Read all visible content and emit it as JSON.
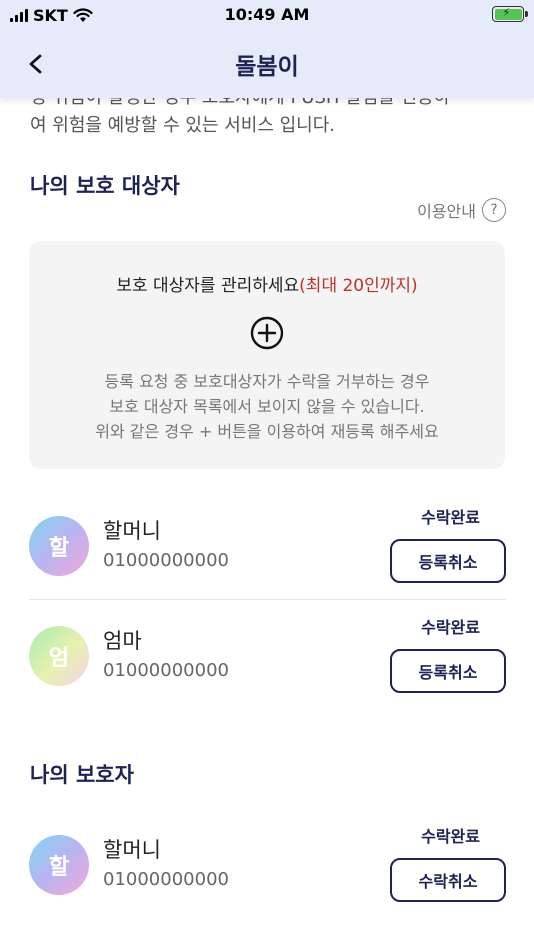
{
  "status_bar": {
    "carrier": "SKT",
    "time": "10:49 AM"
  },
  "header": {
    "title": "돌봄이"
  },
  "intro": {
    "line1": "정 위험이 발생한 경우 보호자에게 PUSH 알림을 전송하",
    "line2": "여 위험을 예방할 수 있는 서비스 입니다."
  },
  "protected": {
    "title": "나의 보호 대상자",
    "guide_label": "이용안내",
    "manage": {
      "heading": "보호 대상자를 관리하세요",
      "limit": "(최대 20인까지)",
      "note_lines": [
        "등록 요청 중 보호대상자가 수락을 거부하는 경우",
        "보호 대상자 목록에서 보이지 않을 수 있습니다.",
        "위와 같은 경우 + 버튼을 이용하여 재등록 해주세요"
      ]
    },
    "people": [
      {
        "initial": "할",
        "name": "할머니",
        "phone": "01000000000",
        "status": "수락완료",
        "action": "등록취소"
      },
      {
        "initial": "엄",
        "name": "엄마",
        "phone": "01000000000",
        "status": "수락완료",
        "action": "등록취소"
      }
    ]
  },
  "guardians": {
    "title": "나의 보호자",
    "people": [
      {
        "initial": "할",
        "name": "할머니",
        "phone": "01000000000",
        "status": "수락완료",
        "action": "수락취소"
      }
    ]
  },
  "colors": {
    "accent": "#1d2453",
    "limit_red": "#c0302b",
    "header_bg": "#e6ebfa"
  }
}
